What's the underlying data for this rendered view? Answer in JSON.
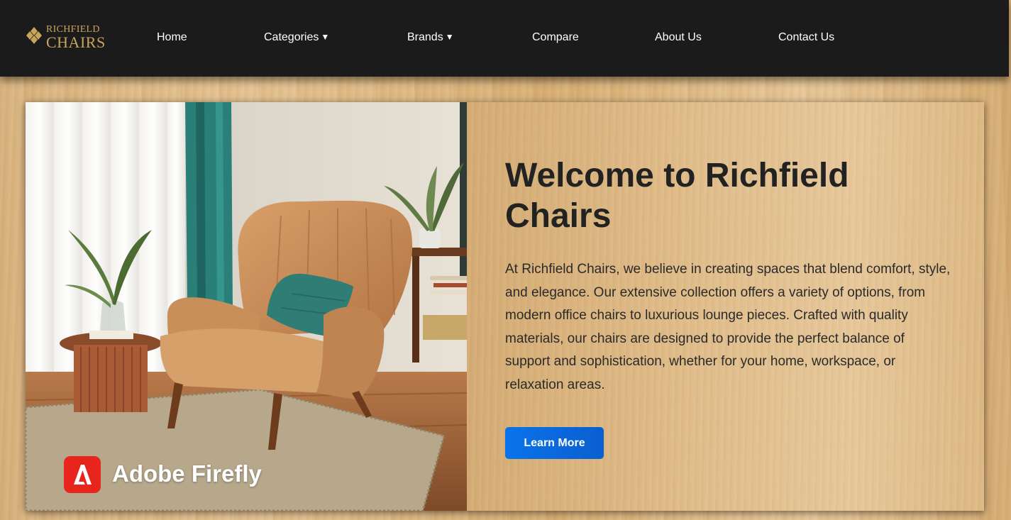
{
  "brand": {
    "name_top": "RICHFIELD",
    "name_bottom": "CHAIRS",
    "logo_color": "#c9a45c",
    "logo_icon": "diamond-cluster-icon"
  },
  "nav": {
    "items": [
      {
        "label": "Home"
      },
      {
        "label": "Categories",
        "caret": "▼"
      },
      {
        "label": "Brands",
        "caret": "▼"
      },
      {
        "label": "Compare"
      },
      {
        "label": "About Us"
      },
      {
        "label": "Contact Us"
      }
    ],
    "background": "#1b1b1b"
  },
  "hero": {
    "title": "Welcome to Richfield Chairs",
    "description": "At Richfield Chairs, we believe in creating spaces that blend comfort, style, and elegance. Our extensive collection offers a variety of options, from modern office chairs to luxurious lounge pieces. Crafted with quality materials, our chairs are designed to provide the perfect balance of support and sophistication, whether for your home, workspace, or relaxation areas.",
    "button_label": "Learn More",
    "button_color": "#0a6ce0",
    "image_badge": "Adobe Firefly",
    "image_badge_color": "#e7251d"
  }
}
